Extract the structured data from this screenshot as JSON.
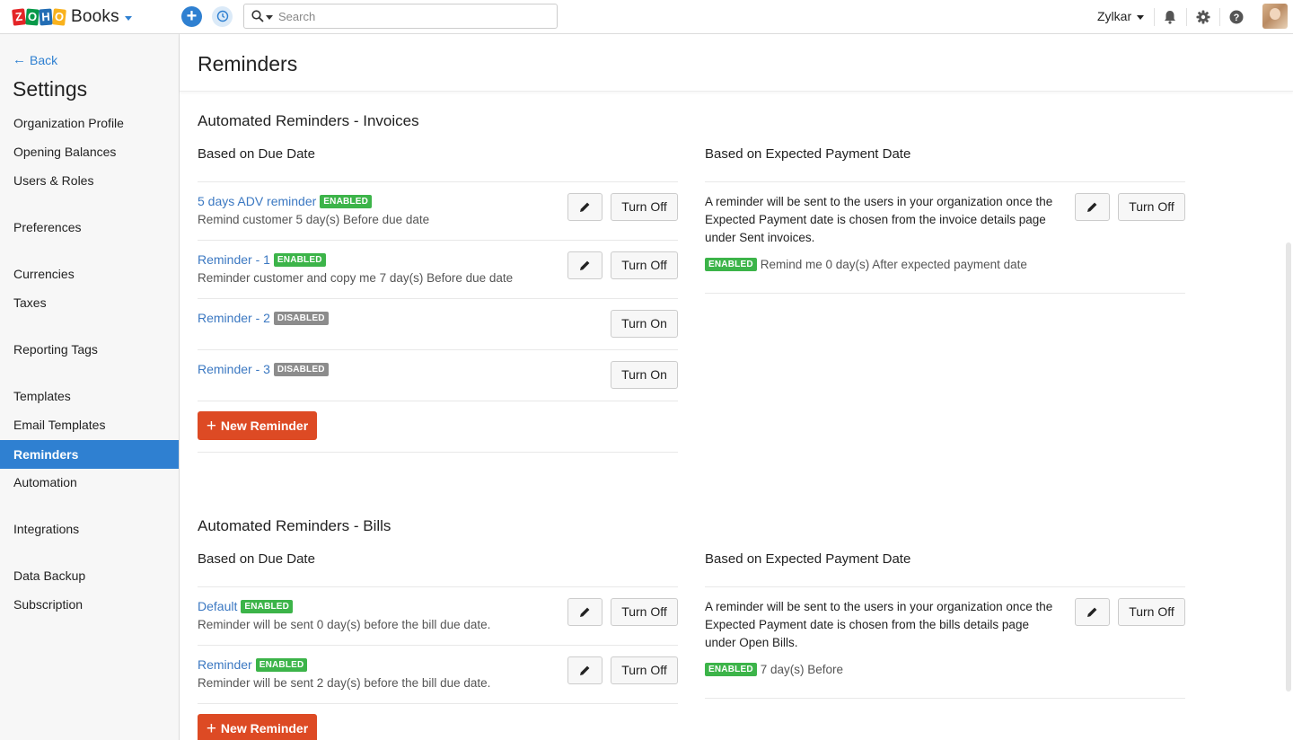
{
  "topbar": {
    "logo_letters": [
      "Z",
      "O",
      "H",
      "O"
    ],
    "app_name": "Books",
    "search_placeholder": "Search",
    "org_name": "Zylkar"
  },
  "sidebar": {
    "back_label": "Back",
    "title": "Settings",
    "items": [
      {
        "label": "Organization Profile",
        "active": false
      },
      {
        "label": "Opening Balances",
        "active": false
      },
      {
        "label": "Users & Roles",
        "active": false
      },
      {
        "label": "Preferences",
        "active": false
      },
      {
        "label": "Currencies",
        "active": false
      },
      {
        "label": "Taxes",
        "active": false
      },
      {
        "label": "Reporting Tags",
        "active": false
      },
      {
        "label": "Templates",
        "active": false
      },
      {
        "label": "Email Templates",
        "active": false
      },
      {
        "label": "Reminders",
        "active": true
      },
      {
        "label": "Automation",
        "active": false
      },
      {
        "label": "Integrations",
        "active": false
      },
      {
        "label": "Data Backup",
        "active": false
      },
      {
        "label": "Subscription",
        "active": false
      }
    ]
  },
  "page": {
    "title": "Reminders"
  },
  "invoices": {
    "section_title": "Automated Reminders - Invoices",
    "due_col_title": "Based on Due Date",
    "expected_col_title": "Based on Expected Payment Date",
    "reminders": [
      {
        "name": "5 days ADV reminder",
        "status": "ENABLED",
        "description": "Remind customer 5 day(s) Before due date",
        "action": "Turn Off"
      },
      {
        "name": "Reminder - 1",
        "status": "ENABLED",
        "description": "Reminder customer and copy me 7 day(s) Before due date",
        "action": "Turn Off"
      },
      {
        "name": "Reminder - 2",
        "status": "DISABLED",
        "description": "",
        "action": "Turn On"
      },
      {
        "name": "Reminder - 3",
        "status": "DISABLED",
        "description": "",
        "action": "Turn On"
      }
    ],
    "new_button": "New Reminder",
    "expected": {
      "text": "A reminder will be sent to the users in your organization once the Expected Payment date is chosen from the invoice details page under Sent invoices.",
      "status": "ENABLED",
      "status_text": "Remind me 0 day(s) After expected payment date",
      "action": "Turn Off"
    }
  },
  "bills": {
    "section_title": "Automated Reminders - Bills",
    "due_col_title": "Based on Due Date",
    "expected_col_title": "Based on Expected Payment Date",
    "reminders": [
      {
        "name": "Default",
        "status": "ENABLED",
        "description": "Reminder will be sent 0 day(s) before the bill due date.",
        "action": "Turn Off"
      },
      {
        "name": "Reminder",
        "status": "ENABLED",
        "description": "Reminder will be sent 2 day(s) before the bill due date.",
        "action": "Turn Off"
      }
    ],
    "new_button": "New Reminder",
    "expected": {
      "text": "A reminder will be sent to the users in your organization once the Expected Payment date is chosen from the bills details page under Open Bills.",
      "status": "ENABLED",
      "status_text": "7 day(s) Before",
      "action": "Turn Off"
    }
  },
  "colors": {
    "accent": "#2f80d1",
    "link": "#3b78c2",
    "enabled": "#3cb449",
    "disabled": "#8c8c8c",
    "primary_button": "#dd4a24"
  },
  "icons": {
    "add": "plus-icon",
    "recent": "history-icon",
    "search": "search-icon",
    "notifications": "bell-icon",
    "settings": "gear-icon",
    "help": "help-icon",
    "edit": "pencil-icon",
    "back": "arrow-left-icon"
  }
}
